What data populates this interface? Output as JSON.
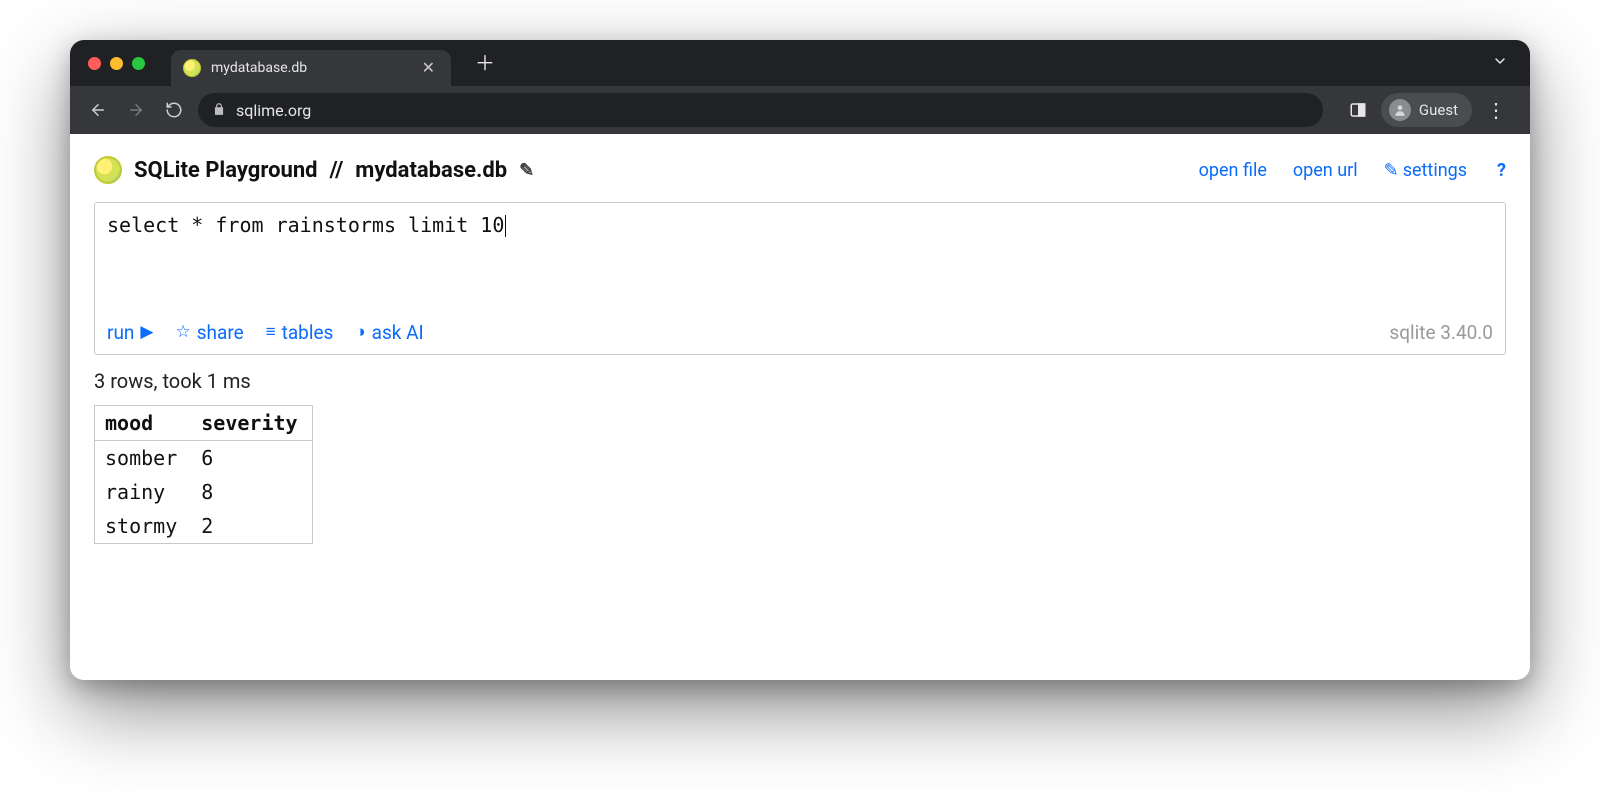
{
  "browser": {
    "tab_title": "mydatabase.db",
    "url": "sqlime.org",
    "guest_label": "Guest"
  },
  "page": {
    "title": "SQLite Playground",
    "separator": "//",
    "db_name": "mydatabase.db",
    "actions": {
      "open_file": "open file",
      "open_url": "open url",
      "settings": "settings",
      "help": "?"
    }
  },
  "editor": {
    "sql": "select * from rainstorms limit 10",
    "actions": {
      "run": "run",
      "share": "share",
      "tables": "tables",
      "ask_ai": "ask AI"
    },
    "version": "sqlite 3.40.0"
  },
  "results": {
    "status": "3 rows, took 1 ms",
    "columns": [
      "mood",
      "severity"
    ],
    "rows": [
      {
        "mood": "somber",
        "severity": 6
      },
      {
        "mood": "rainy",
        "severity": 8
      },
      {
        "mood": "stormy",
        "severity": 2
      }
    ]
  }
}
